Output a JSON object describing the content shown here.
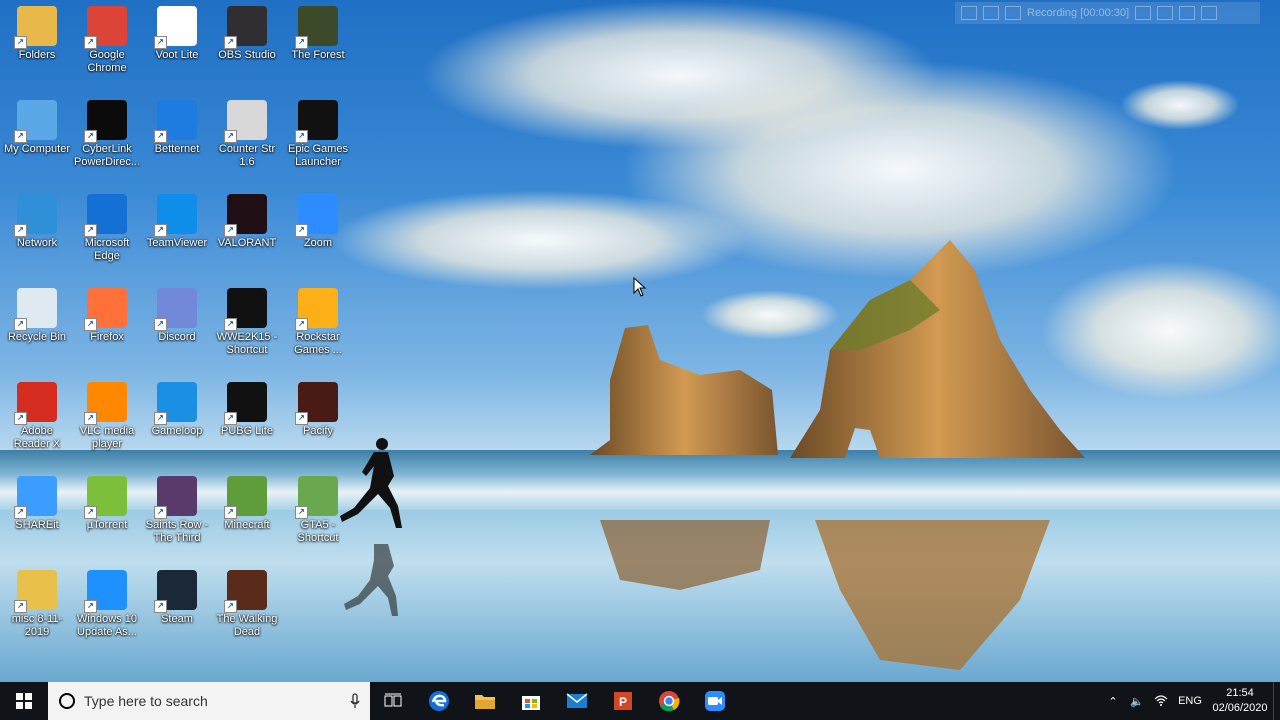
{
  "desktop": {
    "icons": [
      {
        "label": "Folders",
        "icon": "folder-user-icon",
        "color": "#e8b84a"
      },
      {
        "label": "Google Chrome",
        "icon": "chrome-icon",
        "color": "#db4437"
      },
      {
        "label": "Voot Lite",
        "icon": "voot-icon",
        "color": "#ffffff"
      },
      {
        "label": "OBS Studio",
        "icon": "obs-icon",
        "color": "#302e31"
      },
      {
        "label": "The Forest",
        "icon": "the-forest-icon",
        "color": "#3c4a2a"
      },
      {
        "label": "My Computer",
        "icon": "computer-icon",
        "color": "#5aa9e6"
      },
      {
        "label": "CyberLink PowerDirec...",
        "icon": "powerdirector-icon",
        "color": "#0b0b0b"
      },
      {
        "label": "Betternet",
        "icon": "betternet-icon",
        "color": "#1e7ce0"
      },
      {
        "label": "Counter Str 1.6",
        "icon": "counter-strike-icon",
        "color": "#d8d8d8"
      },
      {
        "label": "Epic Games Launcher",
        "icon": "epic-games-icon",
        "color": "#111111"
      },
      {
        "label": "Network",
        "icon": "network-icon",
        "color": "#2f8fd8"
      },
      {
        "label": "Microsoft Edge",
        "icon": "edge-icon",
        "color": "#1570d6"
      },
      {
        "label": "TeamViewer",
        "icon": "teamviewer-icon",
        "color": "#0e8ee9"
      },
      {
        "label": "VALORANT",
        "icon": "valorant-icon",
        "color": "#1f0f14"
      },
      {
        "label": "Zoom",
        "icon": "zoom-icon",
        "color": "#2d8cff"
      },
      {
        "label": "Recycle Bin",
        "icon": "recycle-bin-icon",
        "color": "#dfe9f2"
      },
      {
        "label": "Firefox",
        "icon": "firefox-icon",
        "color": "#ff7139"
      },
      {
        "label": "Discord",
        "icon": "discord-icon",
        "color": "#7289da"
      },
      {
        "label": "WWE2K15 - Shortcut",
        "icon": "wwe-icon",
        "color": "#111111"
      },
      {
        "label": "Rockstar Games ...",
        "icon": "rockstar-icon",
        "color": "#fcaf17"
      },
      {
        "label": "Adobe Reader X",
        "icon": "adobe-reader-icon",
        "color": "#d62b1f"
      },
      {
        "label": "VLC media player",
        "icon": "vlc-icon",
        "color": "#ff8800"
      },
      {
        "label": "Gameloop",
        "icon": "gameloop-icon",
        "color": "#1a8fe3"
      },
      {
        "label": "PUBG Lite",
        "icon": "pubg-lite-icon",
        "color": "#111111"
      },
      {
        "label": "Pacify",
        "icon": "pacify-icon",
        "color": "#4a1a14"
      },
      {
        "label": "SHAREit",
        "icon": "shareit-icon",
        "color": "#3a9dff"
      },
      {
        "label": "µTorrent",
        "icon": "utorrent-icon",
        "color": "#7bbf3a"
      },
      {
        "label": "Saints Row - The Third",
        "icon": "saints-row-icon",
        "color": "#5a3a6a"
      },
      {
        "label": "Minecraft",
        "icon": "minecraft-icon",
        "color": "#5f9c3a"
      },
      {
        "label": "GTA5 - Shortcut",
        "icon": "gta5-icon",
        "color": "#6aa84f"
      },
      {
        "label": "misc 8-11-2019",
        "icon": "zip-folder-icon",
        "color": "#e8c04a"
      },
      {
        "label": "Windows 10 Update As...",
        "icon": "windows-update-icon",
        "color": "#1e90ff"
      },
      {
        "label": "Steam",
        "icon": "steam-icon",
        "color": "#1b2838"
      },
      {
        "label": "The Walking Dead",
        "icon": "walking-dead-icon",
        "color": "#5a2a1a"
      }
    ]
  },
  "recording": {
    "text": "Recording [00:00:30]"
  },
  "taskbar": {
    "search_placeholder": "Type here to search",
    "pinned": [
      {
        "icon": "task-view-icon"
      },
      {
        "icon": "edge-icon"
      },
      {
        "icon": "file-explorer-icon"
      },
      {
        "icon": "microsoft-store-icon"
      },
      {
        "icon": "mail-icon"
      },
      {
        "icon": "powerpoint-icon"
      },
      {
        "icon": "chrome-icon"
      },
      {
        "icon": "zoom-icon"
      }
    ],
    "tray": {
      "language": "ENG",
      "time": "21:54",
      "date": "02/06/2020"
    }
  }
}
